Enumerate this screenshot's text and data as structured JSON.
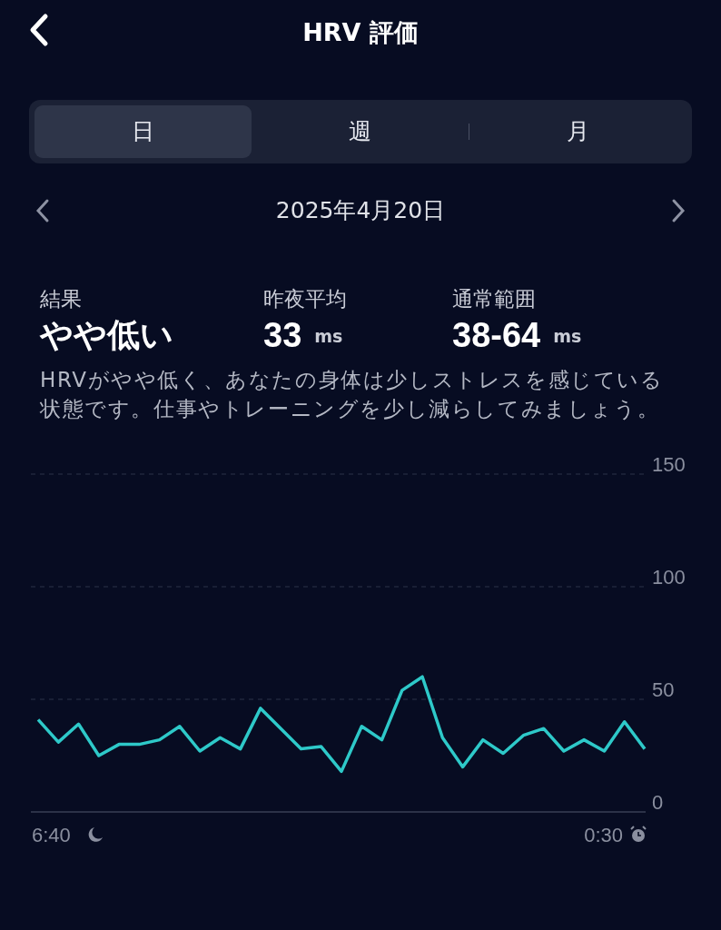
{
  "header": {
    "title": "HRV 評価"
  },
  "tabs": [
    {
      "label": "日",
      "selected": true
    },
    {
      "label": "週",
      "selected": false
    },
    {
      "label": "月",
      "selected": false
    }
  ],
  "date_nav": {
    "date": "2025年4月20日"
  },
  "stats": [
    {
      "label": "結果",
      "value": "やや低い",
      "kind": "text"
    },
    {
      "label": "昨夜平均",
      "value": "33",
      "unit": "ms",
      "kind": "number"
    },
    {
      "label": "通常範囲",
      "value": "38-64",
      "unit": "ms",
      "kind": "number"
    }
  ],
  "description": "HRVがやや低く、あなたの身体は少しストレスを感じている状態です。仕事やトレーニングを少し減らしてみましょう。",
  "chart": {
    "start_label": "6:40",
    "end_label": "0:30",
    "chart_data": {
      "type": "line",
      "ylim": [
        0,
        150
      ],
      "yticks": [
        0,
        50,
        100,
        150
      ],
      "series": [
        {
          "color": "#2ec9c9",
          "values": [
            41,
            31,
            39,
            25,
            30,
            30,
            32,
            38,
            27,
            33,
            28,
            46,
            37,
            28,
            29,
            18,
            38,
            32,
            54,
            60,
            33,
            20,
            32,
            26,
            34,
            37,
            27,
            32,
            27,
            40,
            28
          ]
        }
      ]
    }
  }
}
